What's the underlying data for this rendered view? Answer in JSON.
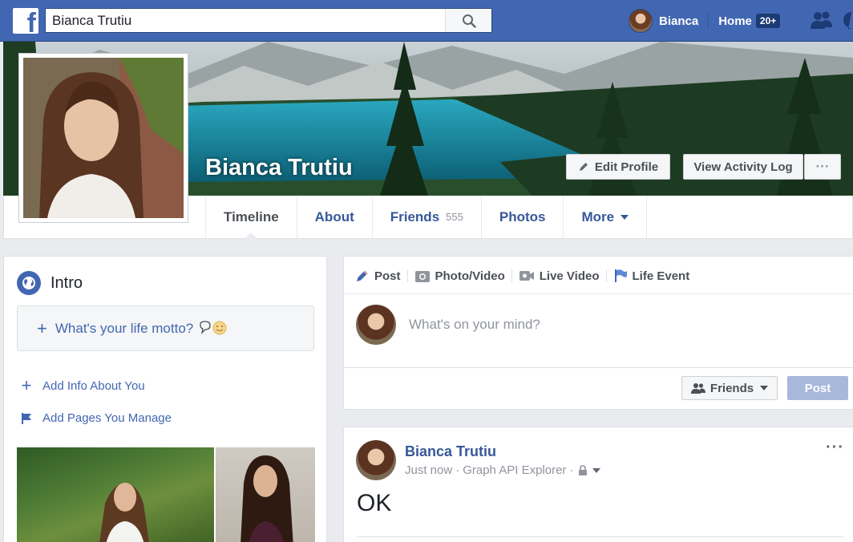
{
  "topbar": {
    "logo": "f",
    "search_value": "Bianca Trutiu",
    "user_name": "Bianca",
    "home_label": "Home",
    "home_badge": "20+"
  },
  "profile": {
    "name": "Bianca Trutiu",
    "edit_profile": "Edit Profile",
    "view_activity_log": "View Activity Log",
    "more_dots": "···"
  },
  "tabs": [
    {
      "label": "Timeline"
    },
    {
      "label": "About"
    },
    {
      "label": "Friends",
      "count": "555"
    },
    {
      "label": "Photos"
    },
    {
      "label": "More"
    }
  ],
  "intro": {
    "title": "Intro",
    "motto": "What's your life motto?",
    "add_info": "Add Info About You",
    "add_pages": "Add Pages You Manage"
  },
  "composer": {
    "tabs": [
      "Post",
      "Photo/Video",
      "Live Video",
      "Life Event"
    ],
    "placeholder": "What's on your mind?",
    "audience": "Friends",
    "post_button": "Post"
  },
  "post": {
    "author": "Bianca Trutiu",
    "time": "Just now",
    "via": "Graph API Explorer",
    "text": "OK",
    "more": "···"
  },
  "colors": {
    "brand": "#4267b2",
    "link": "#365899",
    "page_bg": "#e9ebee"
  }
}
